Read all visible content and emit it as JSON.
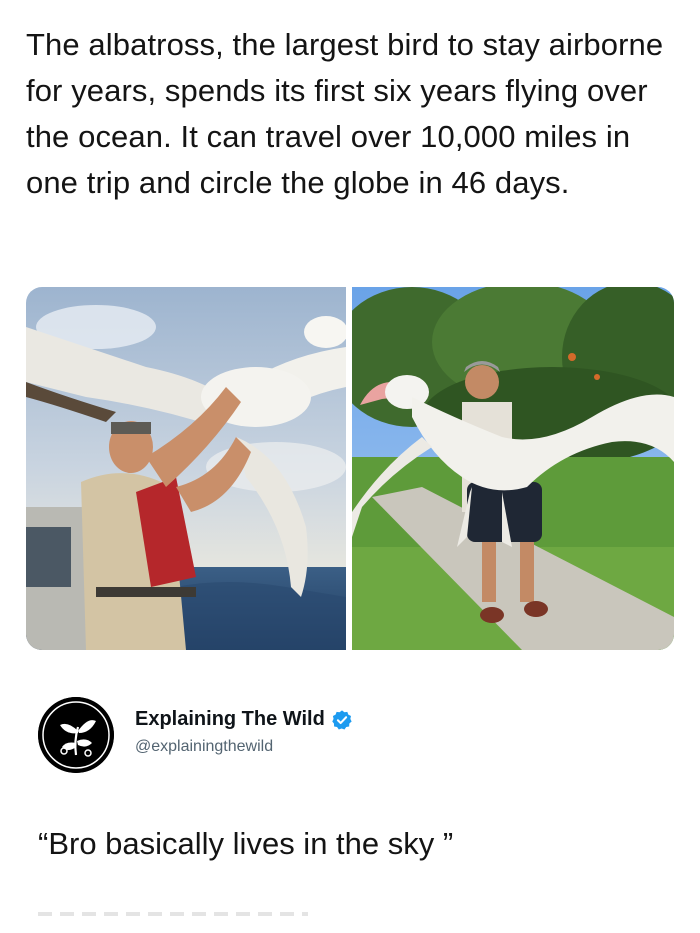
{
  "post": {
    "headline": "The albatross, the largest bird to stay airborne for years, spends its first six years flying over the ocean. It can travel over 10,000 miles in one trip and circle the globe in 46 days."
  },
  "media": {
    "images": [
      {
        "name": "albatross-ranger-photo"
      },
      {
        "name": "albatross-man-lawn-photo"
      }
    ]
  },
  "author": {
    "display_name": "Explaining The Wild",
    "handle": "@explainingthewild",
    "verified_color": "#1d9bf0"
  },
  "reply": {
    "text": "“Bro basically lives in the sky ”"
  },
  "colors": {
    "text": "#141414",
    "secondary": "#536471",
    "accent": "#1d9bf0"
  }
}
